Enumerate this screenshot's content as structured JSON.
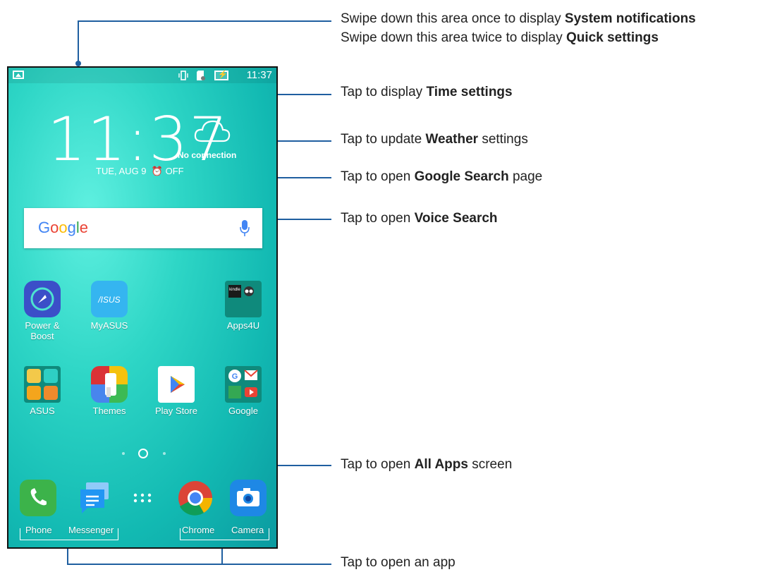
{
  "status_bar": {
    "time": "11:37"
  },
  "clock": {
    "time": "11:37",
    "date": "TUE, AUG 9",
    "alarm": "OFF"
  },
  "weather": {
    "status": "No connection"
  },
  "search": {
    "logo": "Google"
  },
  "apps": {
    "row1": [
      {
        "label_1": "Power &",
        "label_2": "Boost"
      },
      {
        "label": "MyASUS"
      },
      {
        "label": "Apps4U",
        "badge": "kindle"
      }
    ],
    "row2": [
      {
        "label": "ASUS"
      },
      {
        "label": "Themes"
      },
      {
        "label": "Play Store"
      },
      {
        "label": "Google"
      }
    ]
  },
  "dock": [
    {
      "label": "Phone"
    },
    {
      "label": "Messenger"
    },
    {
      "label": ""
    },
    {
      "label": "Chrome"
    },
    {
      "label": "Camera"
    }
  ],
  "callouts": {
    "notifications": {
      "pre": "Swipe down this area once to display ",
      "bold": "System notifications"
    },
    "quick": {
      "pre": "Swipe down this area twice to display ",
      "bold": "Quick settings"
    },
    "time": {
      "pre": "Tap to display ",
      "bold": "Time settings"
    },
    "weather": {
      "pre": "Tap to update ",
      "bold": "Weather",
      "post": " settings"
    },
    "google": {
      "pre": "Tap to open ",
      "bold": "Google Search",
      "post": " page"
    },
    "voice": {
      "pre": "Tap to open ",
      "bold": "Voice Search"
    },
    "allapps": {
      "pre": "Tap to open ",
      "bold": "All Apps",
      "post": " screen"
    },
    "app": {
      "pre": "Tap to open an app"
    }
  },
  "colors": {
    "accent": "#1f5fa0",
    "wallpaper": "#2ed6c6"
  }
}
